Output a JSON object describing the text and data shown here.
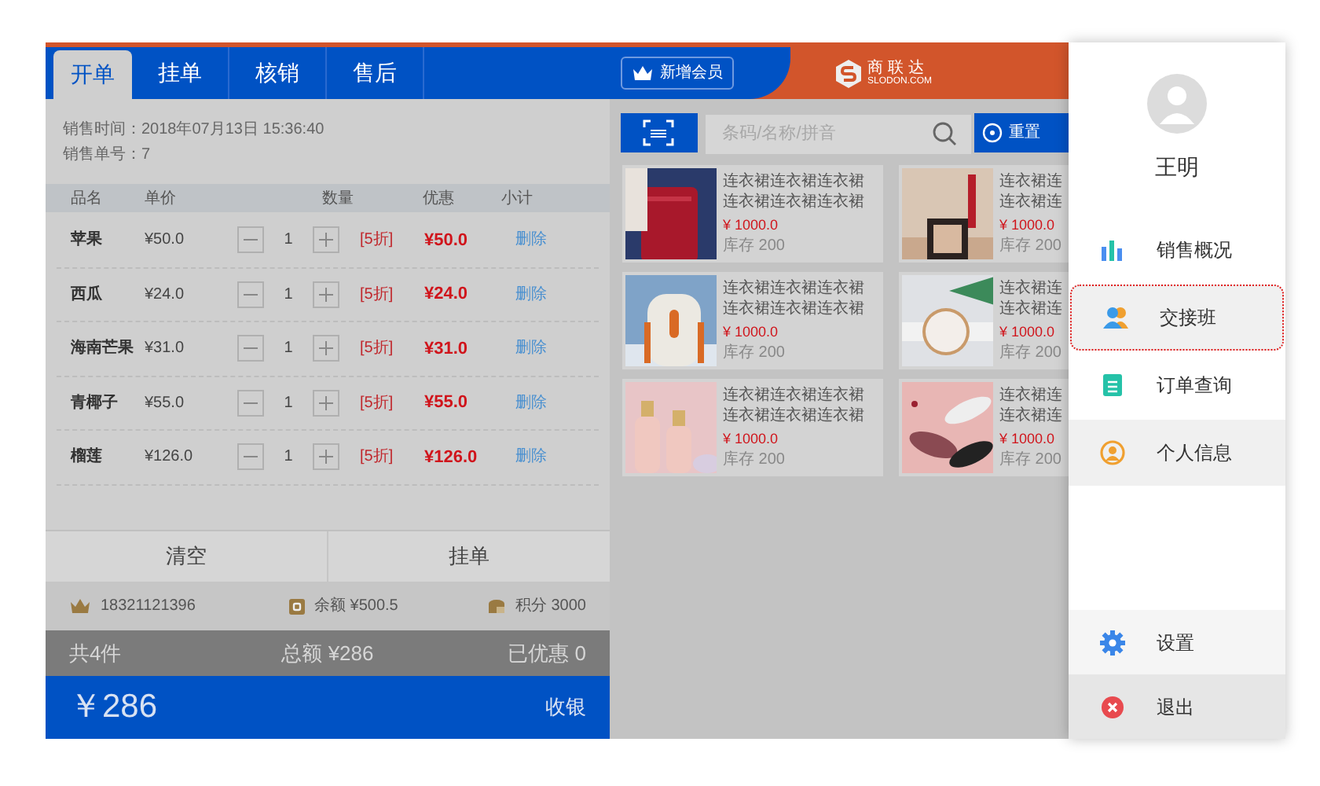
{
  "tabs": [
    {
      "label": "开单",
      "selected": true
    },
    {
      "label": "挂单",
      "selected": false
    },
    {
      "label": "核销",
      "selected": false
    },
    {
      "label": "售后",
      "selected": false
    }
  ],
  "add_member_button": "新增会员",
  "logo": {
    "name": "商联达",
    "site": "SLODON.COM"
  },
  "sale_info": [
    "销售时间：2018年07月13日 15:36:40",
    "销售单号：7"
  ],
  "table": {
    "columns": [
      "品名",
      "单价",
      "数量",
      "优惠",
      "小计"
    ],
    "rows": [
      {
        "name": "苹果",
        "price": "¥50.0",
        "qty": "1",
        "discount": "[5折]",
        "subtotal": "¥50.0",
        "action": "删除"
      },
      {
        "name": "西瓜",
        "price": "¥24.0",
        "qty": "1",
        "discount": "[5折]",
        "subtotal": "¥24.0",
        "action": "删除"
      },
      {
        "name": "海南芒果",
        "price": "¥31.0",
        "qty": "1",
        "discount": "[5折]",
        "subtotal": "¥31.0",
        "action": "删除"
      },
      {
        "name": "青椰子",
        "price": "¥55.0",
        "qty": "1",
        "discount": "[5折]",
        "subtotal": "¥55.0",
        "action": "删除"
      },
      {
        "name": "榴莲",
        "price": "¥126.0",
        "qty": "1",
        "discount": "[5折]",
        "subtotal": "¥126.0",
        "action": "删除"
      }
    ]
  },
  "actions": [
    "清空",
    "挂单"
  ],
  "member": {
    "phone": "18321121396",
    "balance": "余额 ¥500.5",
    "points": "积分 3000"
  },
  "summary": {
    "count": "共4件",
    "total": "总额 ¥286",
    "saved": "已优惠 0"
  },
  "checkout": {
    "amount": "￥286",
    "button": "收银"
  },
  "search": {
    "placeholder": "条码/名称/拼音",
    "reset": "重置"
  },
  "products": [
    {
      "name_lines": [
        "连衣裙连衣裙连衣裙",
        "连衣裙连衣裙连衣裙"
      ],
      "price": "¥ 1000.0",
      "stock": "库存 200"
    },
    {
      "name_lines": [
        "连衣裙连",
        "连衣裙连"
      ],
      "price": "¥ 1000.0",
      "stock": "库存 200"
    },
    {
      "name_lines": [
        "连衣裙连衣裙连衣裙",
        "连衣裙连衣裙连衣裙"
      ],
      "price": "¥ 1000.0",
      "stock": "库存 200"
    },
    {
      "name_lines": [
        "连衣裙连",
        "连衣裙连"
      ],
      "price": "¥ 1000.0",
      "stock": "库存 200"
    },
    {
      "name_lines": [
        "连衣裙连衣裙连衣裙",
        "连衣裙连衣裙连衣裙"
      ],
      "price": "¥ 1000.0",
      "stock": "库存 200"
    },
    {
      "name_lines": [
        "连衣裙连",
        "连衣裙连"
      ],
      "price": "¥ 1000.0",
      "stock": "库存 200"
    }
  ],
  "drawer": {
    "user": "王明",
    "menu": [
      {
        "label": "销售概况",
        "kind": "chart",
        "selected": false,
        "shaded": false
      },
      {
        "label": "交接班",
        "kind": "handover",
        "selected": true,
        "shaded": true
      },
      {
        "label": "订单查询",
        "kind": "orders",
        "selected": false,
        "shaded": false
      },
      {
        "label": "个人信息",
        "kind": "profile",
        "selected": false,
        "shaded": true
      }
    ],
    "bottom": [
      {
        "label": "设置",
        "kind": "settings"
      },
      {
        "label": "退出",
        "kind": "logout"
      }
    ]
  }
}
